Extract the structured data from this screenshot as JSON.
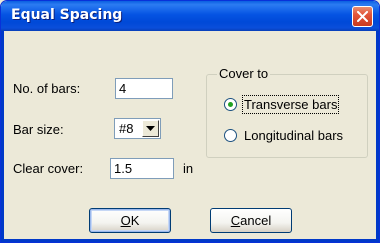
{
  "window": {
    "title": "Equal Spacing"
  },
  "form": {
    "num_bars_label": "No. of bars:",
    "num_bars_value": "4",
    "bar_size_label": "Bar size:",
    "bar_size_value": "#8",
    "clear_cover_label": "Clear cover:",
    "clear_cover_value": "1.5",
    "clear_cover_unit": "in"
  },
  "cover_to": {
    "title": "Cover to",
    "options": [
      {
        "label": "Transverse bars",
        "selected": true
      },
      {
        "label": "Longitudinal bars",
        "selected": false
      }
    ]
  },
  "buttons": {
    "ok_mnemonic": "O",
    "ok_rest": "K",
    "cancel_mnemonic": "C",
    "cancel_rest": "ancel"
  },
  "icons": {
    "close": "close-icon",
    "dropdown": "chevron-down-icon"
  },
  "colors": {
    "titlebar": "#0554E3",
    "close_button": "#E2543A",
    "dialog_background": "#ECE9D8"
  }
}
